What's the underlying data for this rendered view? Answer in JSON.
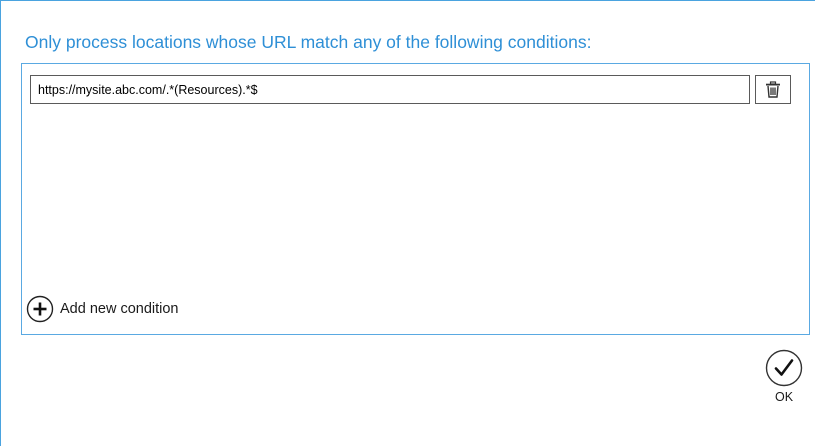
{
  "dialog": {
    "heading": "Only process locations whose URL match any of the following conditions:",
    "accent_color": "#2e8fd6"
  },
  "conditions": {
    "items": [
      {
        "value": "https://mysite.abc.com/.*(Resources).*$",
        "delete_icon": "trash-icon"
      }
    ],
    "add_label": "Add new condition",
    "add_icon": "plus-circle-icon"
  },
  "actions": {
    "ok_label": "OK",
    "ok_icon": "checkmark-circle-icon"
  }
}
